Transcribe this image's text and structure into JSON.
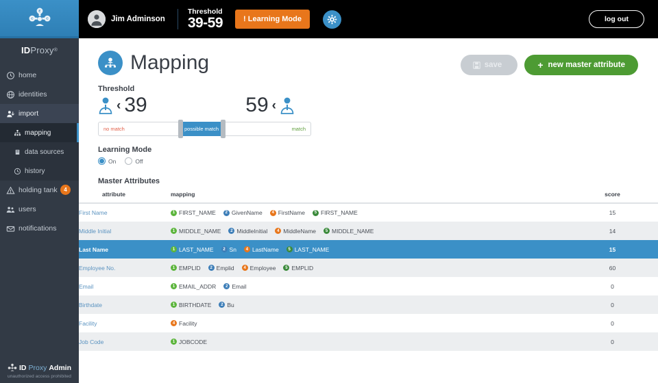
{
  "brand": {
    "logo_icon": "identity-network-icon",
    "sidebar_wordmark_id": "ID",
    "sidebar_wordmark_proxy": "Proxy",
    "sidebar_wordmark_tm": "®",
    "footer_logo_icon": "identity-network-icon",
    "footer_id": "ID",
    "footer_proxy": "Proxy",
    "footer_admin": "Admin",
    "footer_note": "unauthorized access prohibited",
    "accent_blue": "#3b90c7",
    "accent_orange": "#e8761b",
    "accent_green": "#4d9b33",
    "sidebar_bg": "#323a45",
    "topbar_bg": "#000000"
  },
  "sidebar": {
    "items": [
      {
        "label": "home",
        "icon": "clock-icon",
        "level": 0,
        "state": "default"
      },
      {
        "label": "identities",
        "icon": "globe-icon",
        "level": 0,
        "state": "default"
      },
      {
        "label": "import",
        "icon": "user-import-icon",
        "level": 0,
        "state": "active-parent"
      },
      {
        "label": "mapping",
        "icon": "hierarchy-icon",
        "level": 1,
        "state": "selected"
      },
      {
        "label": "data sources",
        "icon": "database-icon",
        "level": 1,
        "state": "default"
      },
      {
        "label": "history",
        "icon": "history-clock-icon",
        "level": 1,
        "state": "default"
      },
      {
        "label": "holding tank",
        "icon": "warning-triangle-icon",
        "level": 0,
        "state": "default",
        "badge": "4"
      },
      {
        "label": "users",
        "icon": "users-icon",
        "level": 0,
        "state": "default"
      },
      {
        "label": "notifications",
        "icon": "envelope-icon",
        "level": 0,
        "state": "default"
      }
    ]
  },
  "topbar": {
    "avatar_icon": "user-avatar-icon",
    "user_name": "Jim Adminson",
    "threshold_label": "Threshold",
    "threshold_value": "39-59",
    "learning_mode_chip": "! Learning Mode",
    "gear_icon": "gear-icon",
    "logout_label": "log out"
  },
  "page": {
    "icon": "hierarchy-circle-icon",
    "title": "Mapping",
    "save_label": "save",
    "save_icon": "floppy-disk-icon",
    "new_attr_label": "new master attribute",
    "new_attr_icon": "plus-icon"
  },
  "threshold": {
    "section_label": "Threshold",
    "low_icon": "person-icon",
    "low_caret": "‹",
    "low_value": "39",
    "high_value": "59",
    "high_caret": "‹",
    "high_icon": "person-icon",
    "slider": {
      "no_match_label": "no match",
      "possible_match_label": "possible match",
      "match_label": "match",
      "no_match_color": "#e2604a",
      "possible_match_color": "#3b90c7",
      "match_color": "#5f9e3d",
      "handle_left_label": "threshold-low-handle",
      "handle_right_label": "threshold-high-handle"
    }
  },
  "learning_mode": {
    "section_label": "Learning Mode",
    "options": [
      {
        "label": "On",
        "selected": true
      },
      {
        "label": "Off",
        "selected": false
      }
    ]
  },
  "master_attributes": {
    "section_label": "Master Attributes",
    "columns": [
      "attribute",
      "mapping",
      "score"
    ],
    "source_colors": {
      "1": "#5cb53c",
      "2": "#3d7eb8",
      "4": "#e8761b",
      "5": "#3b8a3b"
    },
    "rows": [
      {
        "attribute": "First Name",
        "score": "15",
        "selected": false,
        "mappings": [
          {
            "source": "1",
            "name": "FIRST_NAME"
          },
          {
            "source": "2",
            "name": "GivenName"
          },
          {
            "source": "4",
            "name": "FirstName"
          },
          {
            "source": "5",
            "name": "FIRST_NAME"
          }
        ]
      },
      {
        "attribute": "Middle Initial",
        "score": "14",
        "selected": false,
        "mappings": [
          {
            "source": "1",
            "name": "MIDDLE_NAME"
          },
          {
            "source": "2",
            "name": "MiddleInitial"
          },
          {
            "source": "4",
            "name": "MiddleName"
          },
          {
            "source": "5",
            "name": "MIDDLE_NAME"
          }
        ]
      },
      {
        "attribute": "Last Name",
        "score": "15",
        "selected": true,
        "mappings": [
          {
            "source": "1",
            "name": "LAST_NAME"
          },
          {
            "source": "2",
            "name": "Sn"
          },
          {
            "source": "4",
            "name": "LastName"
          },
          {
            "source": "5",
            "name": "LAST_NAME"
          }
        ]
      },
      {
        "attribute": "Employee No.",
        "score": "60",
        "selected": false,
        "mappings": [
          {
            "source": "1",
            "name": "EMPLID"
          },
          {
            "source": "2",
            "name": "Emplid"
          },
          {
            "source": "4",
            "name": "Employee"
          },
          {
            "source": "5",
            "name": "EMPLID"
          }
        ]
      },
      {
        "attribute": "Email",
        "score": "0",
        "selected": false,
        "mappings": [
          {
            "source": "1",
            "name": "EMAIL_ADDR"
          },
          {
            "source": "2",
            "name": "Email"
          }
        ]
      },
      {
        "attribute": "Birthdate",
        "score": "0",
        "selected": false,
        "mappings": [
          {
            "source": "1",
            "name": "BIRTHDATE"
          },
          {
            "source": "2",
            "name": "Bu"
          }
        ]
      },
      {
        "attribute": "Facility",
        "score": "0",
        "selected": false,
        "mappings": [
          {
            "source": "4",
            "name": "Facility"
          }
        ]
      },
      {
        "attribute": "Job Code",
        "score": "0",
        "selected": false,
        "mappings": [
          {
            "source": "1",
            "name": "JOBCODE"
          }
        ]
      }
    ]
  }
}
